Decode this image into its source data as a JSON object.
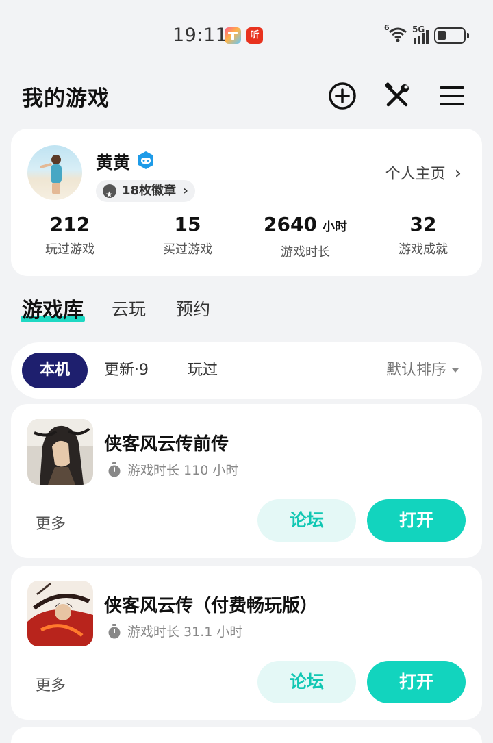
{
  "status_bar": {
    "time": "19:11",
    "app_icon_2_text": "听",
    "signal": "5G",
    "wifi_badge": "6"
  },
  "header": {
    "title": "我的游戏",
    "icons": [
      "add-circle-icon",
      "tools-icon",
      "menu-icon"
    ]
  },
  "profile": {
    "name": "黄黄",
    "badges_label": "18枚徽章",
    "homepage_link": "个人主页",
    "stats": [
      {
        "value": "212",
        "unit": "",
        "label": "玩过游戏"
      },
      {
        "value": "15",
        "unit": "",
        "label": "买过游戏"
      },
      {
        "value": "2640",
        "unit": "小时",
        "label": "游戏时长"
      },
      {
        "value": "32",
        "unit": "",
        "label": "游戏成就"
      }
    ]
  },
  "main_tabs": [
    {
      "label": "游戏库",
      "active": true
    },
    {
      "label": "云玩",
      "active": false
    },
    {
      "label": "预约",
      "active": false
    }
  ],
  "filters": {
    "chips": [
      {
        "label": "本机",
        "active": true
      },
      {
        "label": "更新·9",
        "active": false
      },
      {
        "label": "玩过",
        "active": false
      }
    ],
    "sort_label": "默认排序"
  },
  "games": [
    {
      "title": "侠客风云传前传",
      "time_text": "游戏时长 110 小时",
      "more_label": "更多",
      "forum_label": "论坛",
      "open_label": "打开"
    },
    {
      "title": "侠客风云传（付费畅玩版）",
      "time_text": "游戏时长 31.1 小时",
      "more_label": "更多",
      "forum_label": "论坛",
      "open_label": "打开"
    }
  ],
  "colors": {
    "accent": "#12d4be",
    "accent_light": "#e4f8f6",
    "chip_active": "#1e1f6e",
    "background": "#f2f3f5"
  }
}
